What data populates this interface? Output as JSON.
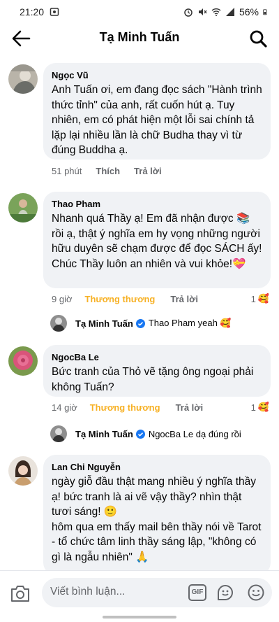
{
  "status_bar": {
    "time": "21:20",
    "battery": "56%",
    "icons": [
      "image-icon",
      "alarm-icon",
      "mute-icon",
      "wifi-icon",
      "signal-icon",
      "battery-icon"
    ]
  },
  "header": {
    "title": "Tạ Minh Tuấn",
    "icons": [
      "back-arrow-icon",
      "search-icon"
    ]
  },
  "comments": [
    {
      "name": "Ngọc Vũ",
      "text": "Anh Tuấn ơi, em đang đọc sách \"Hành trình thức tỉnh\" của anh, rất cuốn hút ạ. Tuy nhiên, em có phát hiện một lỗi sai chính tả lặp lại nhiều lần là chữ Budha thay vì từ đúng Buddha ạ.",
      "time": "51 phút",
      "like_label": "Thích",
      "reply_label": "Trả lời"
    },
    {
      "name": "Thao Pham",
      "text": "Nhanh quá Thầy ạ! Em đã nhận được 📚 rồi ạ, thật ý nghĩa em hy vọng những người hữu duyên sẽ chạm được để đọc SÁCH ấy! Chúc Thầy luôn an nhiên và vui khỏe!💝",
      "time": "9 giờ",
      "like_label": "Thương thương",
      "reply_label": "Trả lời",
      "reaction_count": "1",
      "reaction_emoji": "🥰",
      "reply": {
        "name": "Tạ Minh Tuấn",
        "text": "Thao Pham yeah 🥰"
      }
    },
    {
      "name": "NgocBa Le",
      "text": "Bức tranh của Thỏ vẽ tặng ông ngoại phải không Tuấn?",
      "time": "14 giờ",
      "like_label": "Thương thương",
      "reply_label": "Trả lời",
      "reaction_count": "1",
      "reaction_emoji": "🥰",
      "reply": {
        "name": "Tạ Minh Tuấn",
        "text": "NgocBa Le dạ đúng rồi"
      }
    },
    {
      "name": "Lan Chi Nguyễn",
      "text_lines": [
        "ngày giỗ đầu thật mang nhiều ý nghĩa thầy ạ! bức tranh là ai vẽ vậy thầy? nhìn thật tươi sáng! 🙂",
        "hôm qua em thấy mail bên thầy nói về Tarot - tổ chức tâm linh thầy sáng lập, \"không có gì là ngẫu nhiên\" 🙏"
      ]
    }
  ],
  "composer": {
    "placeholder": "Viết bình luận...",
    "gif_label": "GIF",
    "icons": [
      "camera-icon",
      "gif-icon",
      "sticker-icon",
      "emoji-icon"
    ]
  },
  "colors": {
    "love_reaction": "#f7b125",
    "bubble_bg": "#f0f2f5",
    "meta_text": "#65676b",
    "verified": "#1877f2"
  }
}
